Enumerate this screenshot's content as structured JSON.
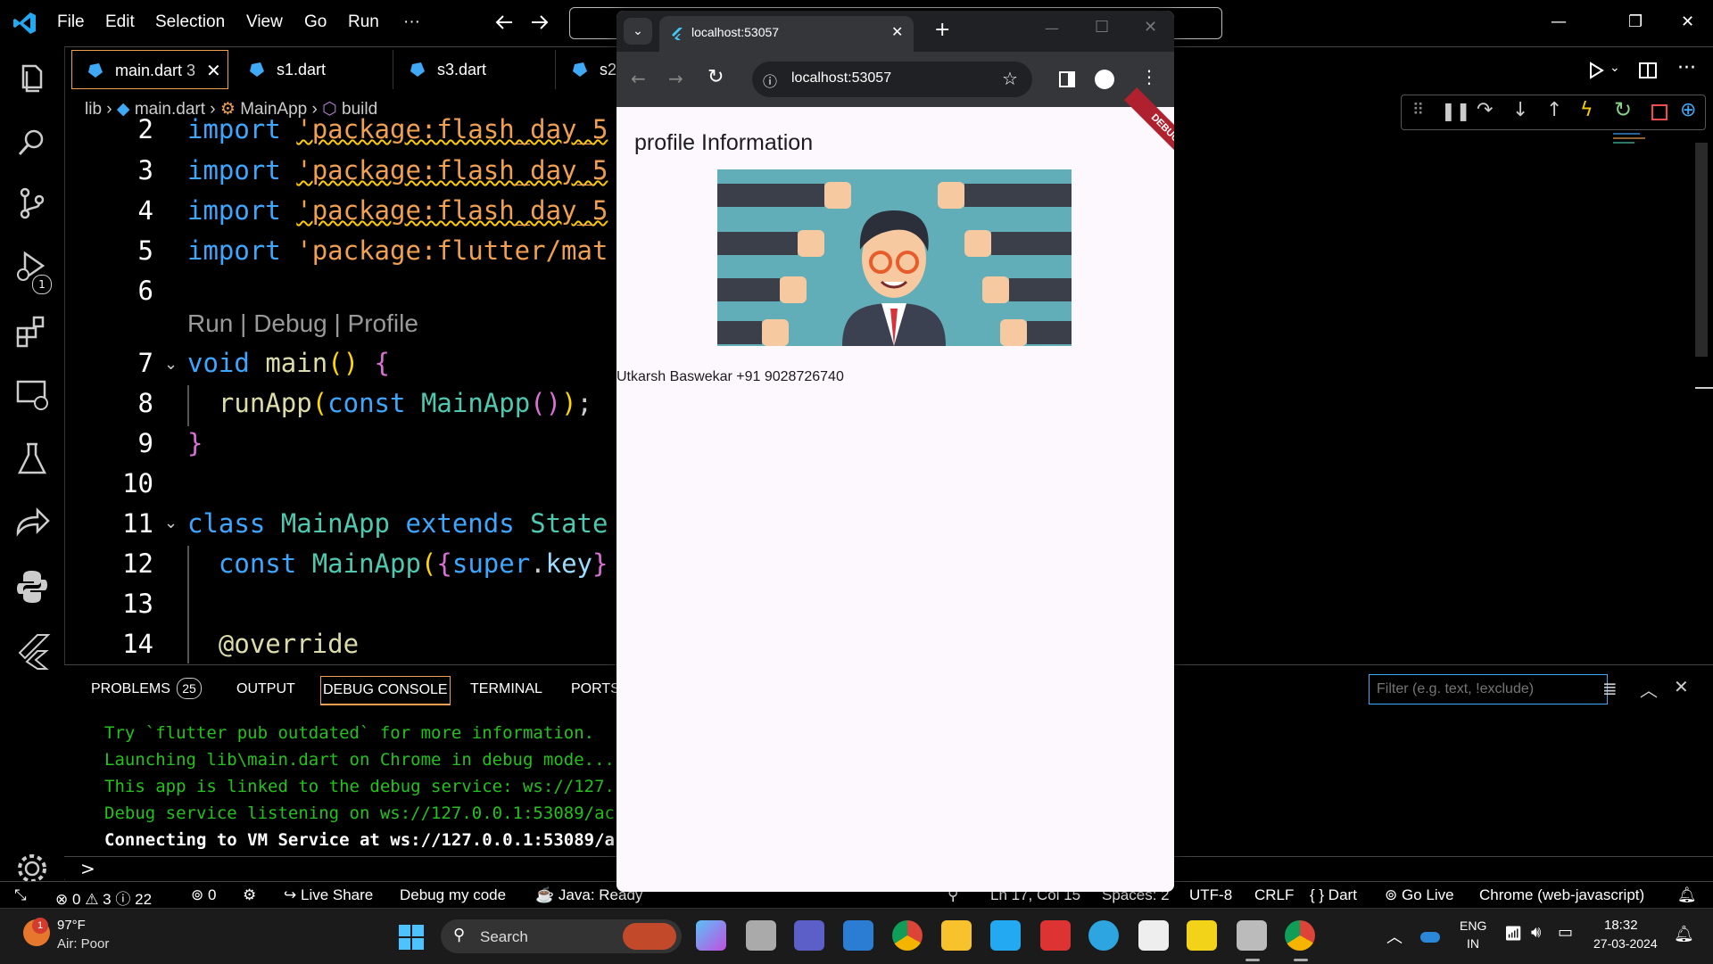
{
  "vscode": {
    "menu": [
      "File",
      "Edit",
      "Selection",
      "View",
      "Go",
      "Run",
      "···"
    ],
    "tabs": [
      {
        "label": "main.dart",
        "badge": "3"
      },
      {
        "label": "s1.dart"
      },
      {
        "label": "s3.dart"
      },
      {
        "label": "s2"
      }
    ],
    "breadcrumb": {
      "root": "lib",
      "file": "main.dart",
      "cls": "MainApp",
      "method": "build"
    },
    "codelens": "Run | Debug | Profile",
    "activity_badge": "1",
    "lines": [
      {
        "n": "2",
        "tokens": [
          {
            "t": "import",
            "c": "kw"
          },
          {
            "t": " "
          },
          {
            "t": "'package:flash_day_5",
            "c": "str",
            "wavy": true
          }
        ]
      },
      {
        "n": "3",
        "tokens": [
          {
            "t": "import",
            "c": "kw"
          },
          {
            "t": " "
          },
          {
            "t": "'package:flash_day_5",
            "c": "str",
            "wavy": true
          }
        ]
      },
      {
        "n": "4",
        "tokens": [
          {
            "t": "import",
            "c": "kw"
          },
          {
            "t": " "
          },
          {
            "t": "'package:flash_day_5",
            "c": "str",
            "wavy": true
          }
        ]
      },
      {
        "n": "5",
        "tokens": [
          {
            "t": "import",
            "c": "kw"
          },
          {
            "t": " "
          },
          {
            "t": "'package:flutter/mat",
            "c": "str"
          }
        ]
      },
      {
        "n": "6",
        "tokens": []
      },
      {
        "n": "7",
        "tokens": [
          {
            "t": "void",
            "c": "kw"
          },
          {
            "t": " "
          },
          {
            "t": "main",
            "c": "fn"
          },
          {
            "t": "()",
            "c": "br"
          },
          {
            "t": " "
          },
          {
            "t": "{",
            "c": "br2"
          }
        ]
      },
      {
        "n": "8",
        "tokens": [
          {
            "t": "  "
          },
          {
            "t": "runApp",
            "c": "fn"
          },
          {
            "t": "(",
            "c": "br"
          },
          {
            "t": "const",
            "c": "kw"
          },
          {
            "t": " "
          },
          {
            "t": "MainApp",
            "c": "cls"
          },
          {
            "t": "()",
            "c": "br2"
          },
          {
            "t": ")",
            "c": "br"
          },
          {
            "t": ";"
          }
        ]
      },
      {
        "n": "9",
        "tokens": [
          {
            "t": "}",
            "c": "br2"
          }
        ]
      },
      {
        "n": "10",
        "tokens": []
      },
      {
        "n": "11",
        "tokens": [
          {
            "t": "class",
            "c": "kw"
          },
          {
            "t": " "
          },
          {
            "t": "MainApp",
            "c": "cls"
          },
          {
            "t": " "
          },
          {
            "t": "extends",
            "c": "kw"
          },
          {
            "t": " "
          },
          {
            "t": "State",
            "c": "cls"
          }
        ]
      },
      {
        "n": "12",
        "tokens": [
          {
            "t": "  "
          },
          {
            "t": "const",
            "c": "kw"
          },
          {
            "t": " "
          },
          {
            "t": "MainApp",
            "c": "cls"
          },
          {
            "t": "(",
            "c": "br"
          },
          {
            "t": "{",
            "c": "br2"
          },
          {
            "t": "super",
            "c": "kw"
          },
          {
            "t": "."
          },
          {
            "t": "key",
            "c": "var"
          },
          {
            "t": "}",
            "c": "br2"
          }
        ]
      },
      {
        "n": "13",
        "tokens": []
      },
      {
        "n": "14",
        "tokens": [
          {
            "t": "  @override",
            "c": "fn"
          }
        ]
      }
    ],
    "panel": {
      "tabs": [
        "PROBLEMS",
        "OUTPUT",
        "DEBUG CONSOLE",
        "TERMINAL",
        "PORTS"
      ],
      "problems_count": "25",
      "filter_placeholder": "Filter (e.g. text, !exclude)",
      "console": [
        "Try `flutter pub outdated` for more information.",
        "Launching lib\\main.dart on Chrome in debug mode...",
        "This app is linked to the debug service: ws://127.",
        "Debug service listening on ws://127.0.0.1:53089/ac",
        "Connecting to VM Service at ws://127.0.0.1:53089/a"
      ],
      "prompt": ">"
    },
    "status": {
      "errors": "0",
      "warnings": "3",
      "infos": "22",
      "ports": "0",
      "live_share": "Live Share",
      "debug_code": "Debug my code",
      "java": "Java: Ready",
      "position": "Ln 17, Col 15",
      "spaces": "Spaces: 2",
      "encoding": "UTF-8",
      "eol": "CRLF",
      "language": "{ } Dart",
      "golive": "Go Live",
      "device": "Chrome (web-javascript)"
    }
  },
  "chrome": {
    "tab_title": "localhost:53057",
    "url": "localhost:53057",
    "page": {
      "heading": "profile Information",
      "debug_banner": "DEBUG",
      "info": "Utkarsh Baswekar +91 9028726740"
    }
  },
  "taskbar": {
    "weather_temp": "97°F",
    "weather_desc": "Air: Poor",
    "weather_badge": "1",
    "search": "Search",
    "lang1": "ENG",
    "lang2": "IN",
    "time": "18:32",
    "date": "27-03-2024"
  }
}
